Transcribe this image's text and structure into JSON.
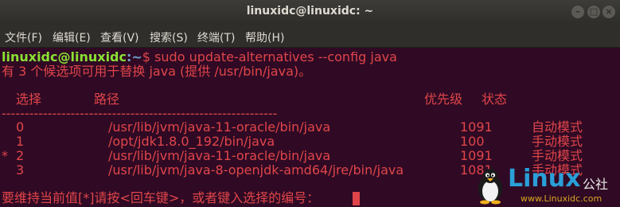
{
  "window": {
    "title": "linuxidc@linuxidc: ~"
  },
  "menu": [
    "文件(F)",
    "编辑(E)",
    "查看(V)",
    "搜索(S)",
    "终端(T)",
    "帮助(H)"
  ],
  "prompt": {
    "user_host": "linuxidc@linuxidc",
    "path": ":~",
    "symbol": "$",
    "command": " sudo update-alternatives --config java"
  },
  "info": "有 3 个候选项可用于替换 java (提供 /usr/bin/java)。",
  "table": {
    "headers": [
      "选择",
      "路径",
      "优先级",
      "状态"
    ],
    "rule": "------------------------------------------------------------",
    "rows": [
      {
        "marker": "",
        "selection": "0",
        "path": "/usr/lib/jvm/java-11-oracle/bin/java",
        "priority": "1091",
        "status": "自动模式"
      },
      {
        "marker": "",
        "selection": "1",
        "path": "/opt/jdk1.8.0_192/bin/java",
        "priority": "100",
        "status": "手动模式"
      },
      {
        "marker": "*",
        "selection": "2",
        "path": "/usr/lib/jvm/java-11-oracle/bin/java",
        "priority": "1091",
        "status": "手动模式"
      },
      {
        "marker": "",
        "selection": "3",
        "path": "/usr/lib/jvm/java-8-openjdk-amd64/jre/bin/java",
        "priority": "1081",
        "status": "手动模式"
      }
    ]
  },
  "input_prompt": "要维持当前值[*]请按<回车键>，或者键入选择的编号：",
  "watermark": {
    "word": "Linux",
    "cn": "公社",
    "url": "www.Linuxidc.com"
  },
  "colors": {
    "background": "#300a24",
    "text": "#e0454a",
    "user": "#8ae234",
    "path": "#729fcf"
  }
}
